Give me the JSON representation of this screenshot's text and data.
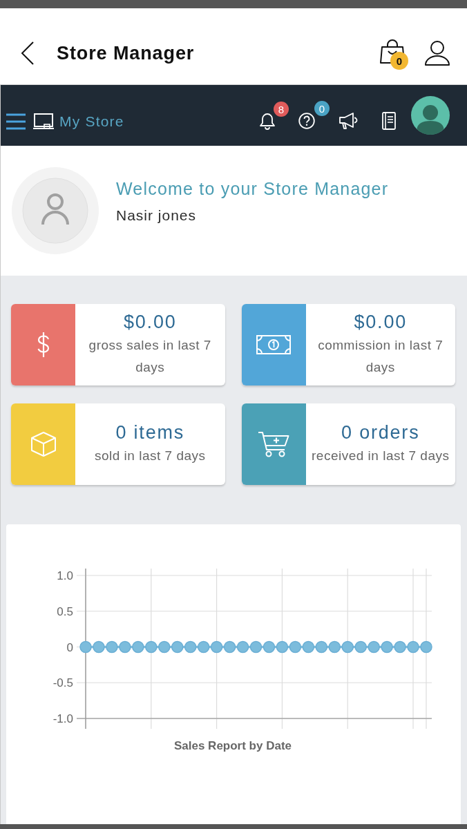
{
  "header": {
    "title": "Store Manager",
    "cart_badge": "0"
  },
  "nav": {
    "brand": "My Store",
    "icons": [
      {
        "kind": "notifications",
        "badge": "8",
        "color": "#e05b5b"
      },
      {
        "kind": "help",
        "badge": "0",
        "color": "#4aa3c4"
      },
      {
        "kind": "announcements"
      },
      {
        "kind": "knowledgebase"
      }
    ]
  },
  "welcome": {
    "title": "Welcome to your Store Manager",
    "name": "Nasir jones"
  },
  "stats": [
    {
      "kind": "sales",
      "color": "#e8746c",
      "value": "$0.00",
      "label": "gross sales in last 7 days"
    },
    {
      "kind": "commission",
      "color": "#52a6d8",
      "value": "$0.00",
      "label": "commission in last 7 days"
    },
    {
      "kind": "items",
      "color": "#f2cc40",
      "value": "0 items",
      "label": "sold in last 7 days"
    },
    {
      "kind": "orders",
      "color": "#4ba1b6",
      "value": "0 orders",
      "label": "received in last 7 days"
    }
  ],
  "chart": {
    "chart_data": {
      "type": "line",
      "title": "Sales Report by Date",
      "grid": true,
      "ylim": [
        -1,
        1
      ],
      "yticks": [
        {
          "value": 1,
          "label": "1.0"
        },
        {
          "value": 0.5,
          "label": "0.5"
        },
        {
          "value": 0,
          "label": "0"
        },
        {
          "value": -0.5,
          "label": "-0.5"
        },
        {
          "value": -1,
          "label": "-1.0"
        }
      ],
      "series": [
        {
          "color": "#7cbcdc",
          "marker": true,
          "values": [
            0,
            0,
            0,
            0,
            0,
            0,
            0,
            0,
            0,
            0,
            0,
            0,
            0,
            0,
            0,
            0,
            0,
            0,
            0,
            0,
            0,
            0,
            0,
            0,
            0,
            0,
            0
          ]
        }
      ]
    }
  }
}
